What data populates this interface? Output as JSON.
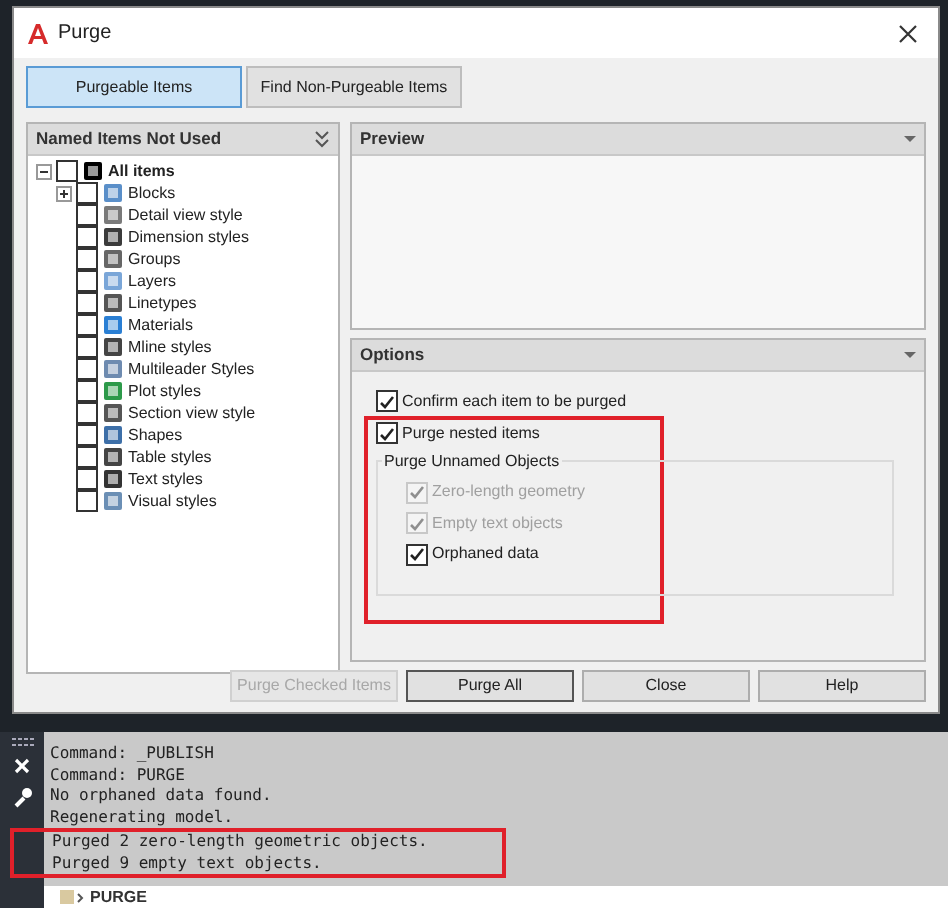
{
  "dialog": {
    "title": "Purge"
  },
  "tabs": [
    {
      "label": "Purgeable Items",
      "selected": true
    },
    {
      "label": "Find Non-Purgeable Items",
      "selected": false
    }
  ],
  "tree": {
    "header": "Named Items Not Used",
    "root": {
      "label": "All items",
      "checked": false,
      "expanded": true,
      "children": [
        {
          "label": "Blocks",
          "checked": false,
          "expanded": false
        },
        {
          "label": "Detail view style",
          "checked": false
        },
        {
          "label": "Dimension styles",
          "checked": false
        },
        {
          "label": "Groups",
          "checked": false
        },
        {
          "label": "Layers",
          "checked": false
        },
        {
          "label": "Linetypes",
          "checked": false
        },
        {
          "label": "Materials",
          "checked": false
        },
        {
          "label": "Mline styles",
          "checked": false
        },
        {
          "label": "Multileader Styles",
          "checked": false
        },
        {
          "label": "Plot styles",
          "checked": false
        },
        {
          "label": "Section view style",
          "checked": false
        },
        {
          "label": "Shapes",
          "checked": false
        },
        {
          "label": "Table styles",
          "checked": false
        },
        {
          "label": "Text styles",
          "checked": false
        },
        {
          "label": "Visual styles",
          "checked": false
        }
      ]
    }
  },
  "preview": {
    "header": "Preview"
  },
  "options": {
    "header": "Options",
    "confirm": {
      "label": "Confirm each item to be purged",
      "checked": true,
      "disabled": false
    },
    "nested": {
      "label": "Purge nested items",
      "checked": true,
      "disabled": false,
      "highlighted": true
    },
    "unnamed_group": {
      "title": "Purge Unnamed Objects",
      "items": [
        {
          "label": "Zero-length geometry",
          "checked": true,
          "disabled": true
        },
        {
          "label": "Empty text objects",
          "checked": true,
          "disabled": true
        },
        {
          "label": "Orphaned data",
          "checked": true,
          "disabled": false
        }
      ]
    }
  },
  "buttons": [
    {
      "label": "Purge Checked Items",
      "disabled": true,
      "default": false
    },
    {
      "label": "Purge All",
      "disabled": false,
      "default": true
    },
    {
      "label": "Close",
      "disabled": false,
      "default": false
    },
    {
      "label": "Help",
      "disabled": false,
      "default": false
    }
  ],
  "command_history": [
    {
      "text": "Command: _PUBLISH",
      "highlighted": false
    },
    {
      "text": "Command: PURGE",
      "highlighted": false
    },
    {
      "text": "No orphaned data found.",
      "highlighted": false
    },
    {
      "text": "Regenerating model.",
      "highlighted": false
    },
    {
      "text": "Purged 2 zero-length geometric objects.",
      "highlighted": true
    },
    {
      "text": "Purged 9 empty text objects.",
      "highlighted": true
    }
  ],
  "command_line": {
    "value": "PURGE"
  }
}
